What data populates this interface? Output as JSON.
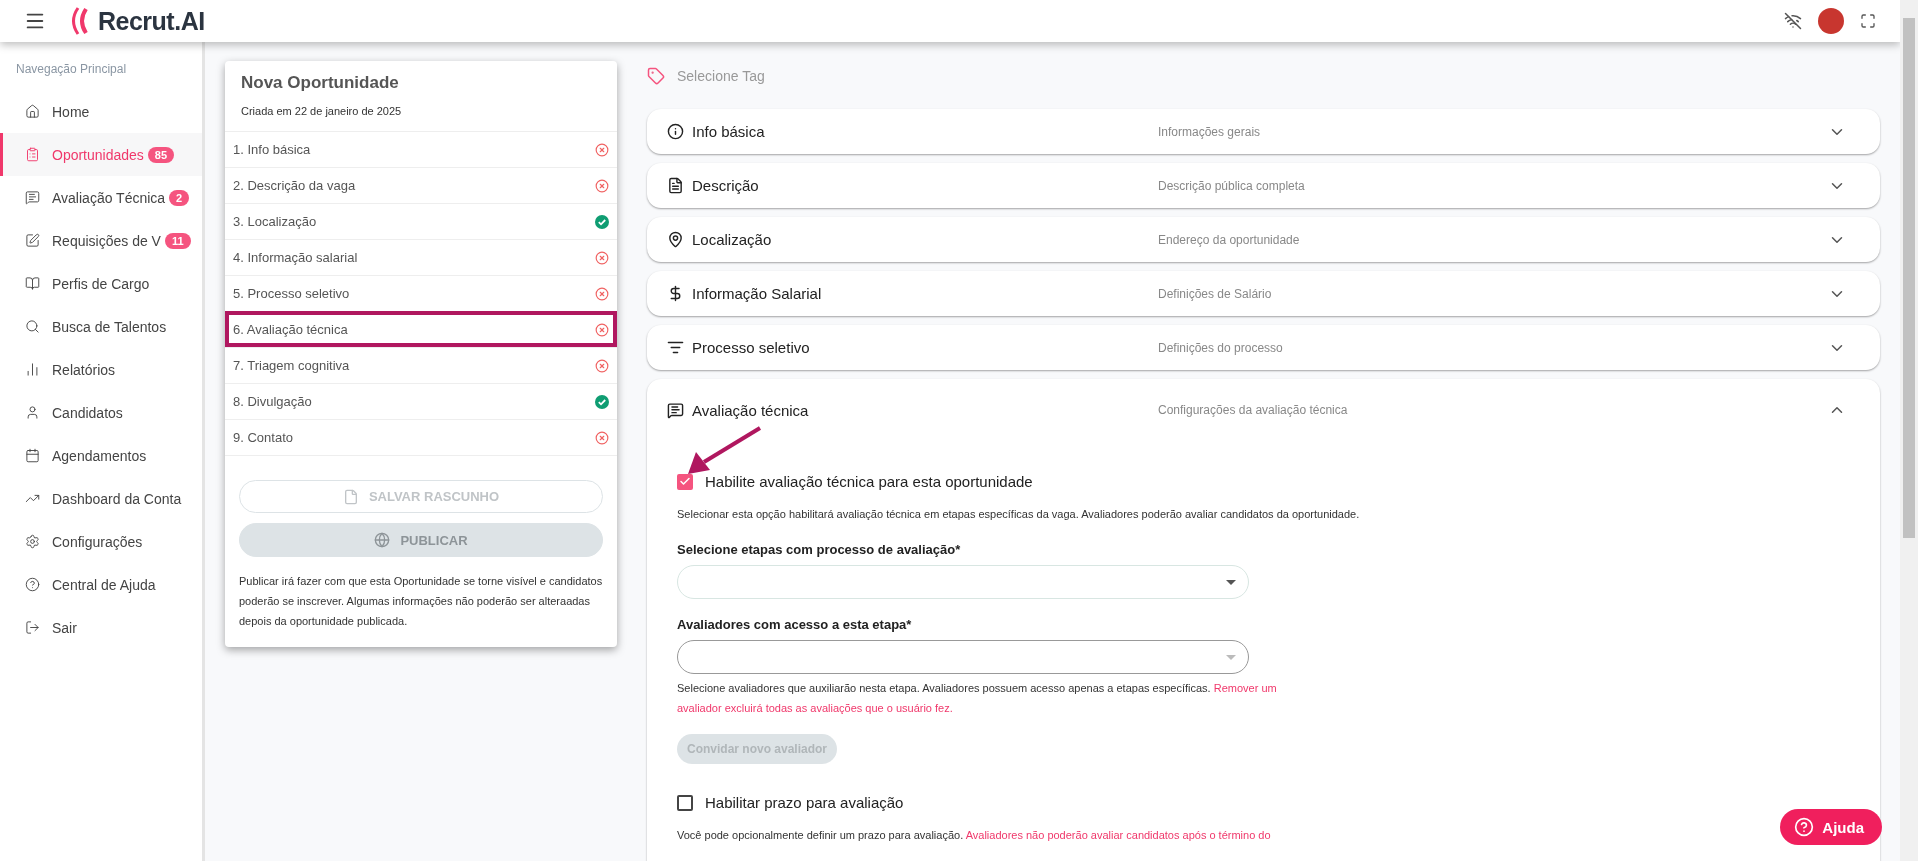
{
  "topbar": {
    "logo": "Recrut.AI"
  },
  "sidebar": {
    "heading": "Navegação Principal",
    "items": [
      {
        "label": "Home",
        "selected": false
      },
      {
        "label": "Oportunidades",
        "badge": "85",
        "selected": true
      },
      {
        "label": "Avaliação Técnica",
        "badge": "2",
        "selected": false
      },
      {
        "label": "Requisições de V",
        "badge": "11",
        "selected": false
      },
      {
        "label": "Perfis de Cargo",
        "selected": false
      },
      {
        "label": "Busca de Talentos",
        "selected": false
      },
      {
        "label": "Relatórios",
        "selected": false
      },
      {
        "label": "Candidatos",
        "selected": false
      },
      {
        "label": "Agendamentos",
        "selected": false
      },
      {
        "label": "Dashboard da Conta",
        "selected": false
      },
      {
        "label": "Configurações",
        "selected": false
      },
      {
        "label": "Central de Ajuda",
        "selected": false
      },
      {
        "label": "Sair",
        "selected": false
      }
    ]
  },
  "card": {
    "title": "Nova Oportunidade",
    "subtitle": "Criada em 22 de janeiro de 2025",
    "steps": [
      {
        "label": "1. Info básica",
        "done": false,
        "selected": false
      },
      {
        "label": "2. Descrição da vaga",
        "done": false,
        "selected": false
      },
      {
        "label": "3. Localização",
        "done": true,
        "selected": false
      },
      {
        "label": "4. Informação salarial",
        "done": false,
        "selected": false
      },
      {
        "label": "5. Processo seletivo",
        "done": false,
        "selected": false
      },
      {
        "label": "6. Avaliação técnica",
        "done": false,
        "selected": true
      },
      {
        "label": "7. Triagem cognitiva",
        "done": false,
        "selected": false
      },
      {
        "label": "8. Divulgação",
        "done": true,
        "selected": false
      },
      {
        "label": "9. Contato",
        "done": false,
        "selected": false
      }
    ],
    "save_button": "SALVAR RASCUNHO",
    "publish_button": "PUBLICAR",
    "note": "Publicar irá fazer com que esta Oportunidade se torne visível e candidatos poderão se inscrever. Algumas informações não poderão ser alteraadas depois da oportunidade publicada."
  },
  "main": {
    "tag": "Selecione Tag",
    "sections": [
      {
        "title": "Info básica",
        "subtitle": "Informações gerais",
        "expanded": false
      },
      {
        "title": "Descrição",
        "subtitle": "Descrição pública completa",
        "expanded": false
      },
      {
        "title": "Localização",
        "subtitle": "Endereço da oportunidade",
        "expanded": false
      },
      {
        "title": "Informação Salarial",
        "subtitle": "Definições de Salário",
        "expanded": false
      },
      {
        "title": "Processo seletivo",
        "subtitle": "Definições do processo",
        "expanded": false
      },
      {
        "title": "Avaliação técnica",
        "subtitle": "Configurações da avaliação técnica",
        "expanded": true
      }
    ],
    "evaluation": {
      "enable": {
        "label": "Habilite avaliação técnica para esta oportunidade",
        "checked": true
      },
      "enable_note": "Selecionar esta opção habilitará avaliação técnica em etapas específicas da vaga. Avaliadores poderão avaliar candidatos da oportunidade.",
      "stages_label": "Selecione etapas com processo de avaliação*",
      "reviewers_label": "Avaliadores com acesso a esta etapa*",
      "reviewers_note": {
        "text": "Selecione avaliadores que auxiliarão nesta etapa. Avaliadores possuem acesso apenas a etapas específicas.",
        "warning": "Remover um avaliador excluirá todas as avaliações que o usuário fez."
      },
      "invite_button": "Convidar novo avaliador",
      "deadline": {
        "label": "Habilitar prazo para avaliação",
        "checked": false
      },
      "deadline_note": {
        "text": "Você pode opcionalmente definir um prazo para avaliação.",
        "warning": "Avaliadores não poderão avaliar candidatos após o término do"
      }
    }
  },
  "help_button": "Ajuda"
}
